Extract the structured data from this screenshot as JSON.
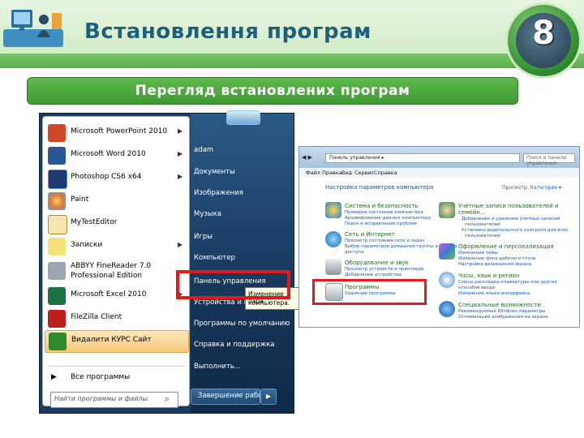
{
  "header": {
    "title": "Встановлення програм",
    "badge_number": "8"
  },
  "subtitle": "Перегляд встановлених програм",
  "start_menu": {
    "left_items": [
      {
        "label": "Microsoft PowerPoint 2010",
        "has_arrow": true,
        "icon": "powerpoint-icon"
      },
      {
        "label": "Microsoft Word 2010",
        "has_arrow": true,
        "icon": "word-icon"
      },
      {
        "label": "Photoshop CS6 x64",
        "has_arrow": true,
        "icon": "photoshop-icon"
      },
      {
        "label": "Paint",
        "has_arrow": false,
        "icon": "paint-icon"
      },
      {
        "label": "MyTestEditor",
        "has_arrow": false,
        "icon": "mytesteditor-icon"
      },
      {
        "label": "Записки",
        "has_arrow": true,
        "icon": "notes-icon"
      },
      {
        "label_line1": "ABBYY FineReader 7.0",
        "label_line2": "Professional Edition",
        "has_arrow": false,
        "icon": "abbyy-icon"
      },
      {
        "label": "Microsoft Excel 2010",
        "has_arrow": true,
        "icon": "excel-icon"
      },
      {
        "label": "FileZilla Client",
        "has_arrow": false,
        "icon": "filezilla-icon"
      },
      {
        "label": "Видалити КУРС Сайт",
        "has_arrow": false,
        "icon": "uninstall-icon"
      }
    ],
    "all_programs": "Все программы",
    "search_placeholder": "Найти программы и файлы",
    "right_items": [
      "adam",
      "Документы",
      "Изображения",
      "Музыка",
      "Игры",
      "Компьютер",
      "Панель управления",
      "Устройства и при",
      "Программы по умолчанию",
      "Справка и поддержка",
      "Выполнить..."
    ],
    "shutdown": "Завершение работы",
    "tooltip_line1": "Изменение пара",
    "tooltip_line2": "компьютера."
  },
  "control_panel": {
    "address": "Панель управления ▸",
    "search": "Поиск в панели управления",
    "menu": [
      "Файл",
      "Правка",
      "Вид",
      "Сервис",
      "Справка"
    ],
    "heading": "Настройка параметров компьютера",
    "view_label": "Просмотр:",
    "view_value": "Категория ▾",
    "categories": [
      {
        "title": "Система и безопасность",
        "links": [
          "Проверка состояния компьютера",
          "Архивирование данных компьютера",
          "Поиск и исправление проблем"
        ],
        "icon": "security-shield-icon"
      },
      {
        "title": "Сеть и Интернет",
        "links": [
          "Просмотр состояния сети и задач",
          "Выбор параметров домашней группы и общего",
          "доступа"
        ],
        "icon": "network-globe-icon"
      },
      {
        "title": "Оборудование и звук",
        "links": [
          "Просмотр устройств и принтеров",
          "Добавление устройства"
        ],
        "icon": "printer-icon"
      },
      {
        "title": "Программы",
        "links": [
          "Удаление программы"
        ],
        "icon": "programs-icon"
      },
      {
        "title": "Учетные записи пользователей и",
        "title2": "семейн...",
        "links": [
          "Добавление и удаление учетных записей",
          "пользователей",
          "Установка родительского контроля для всех",
          "пользователей"
        ],
        "icon": "users-icon"
      },
      {
        "title": "Оформление и персонализация",
        "links": [
          "Изменение темы",
          "Изменение фона рабочего стола",
          "Настройка разрешения экрана"
        ],
        "icon": "personalization-icon"
      },
      {
        "title": "Часы, язык и регион",
        "links": [
          "Смена раскладки клавиатуры или других",
          "способов ввода",
          "Изменение языка интерфейса"
        ],
        "icon": "clock-globe-icon"
      },
      {
        "title": "Специальные возможности",
        "links": [
          "Рекомендуемые Windows параметры",
          "Оптимизация изображения на экране"
        ],
        "icon": "accessibility-icon"
      }
    ]
  },
  "colors": {
    "title": "#1f5f7a",
    "green_bar": "#4aa73c",
    "highlight": "#e21a1a"
  }
}
